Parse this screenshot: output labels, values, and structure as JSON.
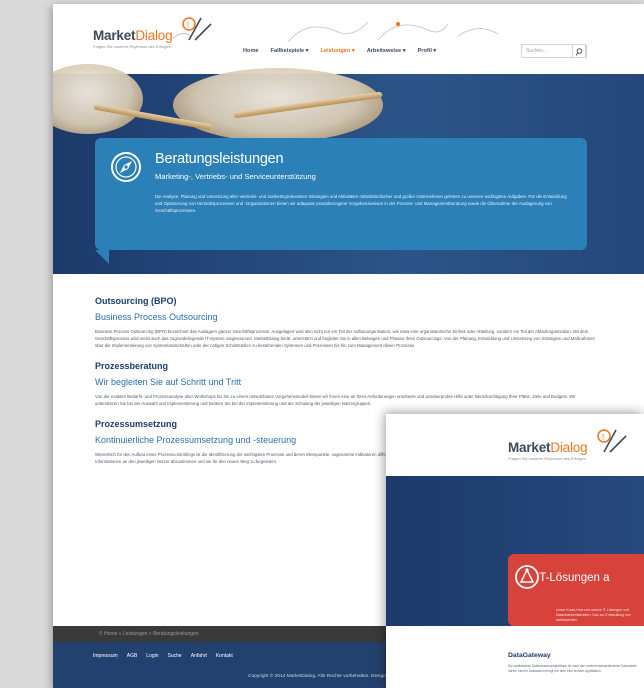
{
  "brand": {
    "name_part1": "Market",
    "name_part2": "Dialog",
    "tagline": "Fragen Sie unseren Rhythmus des Erfolges."
  },
  "nav": {
    "items": [
      {
        "label": "Home",
        "active": false
      },
      {
        "label": "Fallbeispiele ▾",
        "active": false
      },
      {
        "label": "Leistungen ▾",
        "active": true
      },
      {
        "label": "Arbeitsweise ▾",
        "active": false
      },
      {
        "label": "Profil ▾",
        "active": false
      }
    ],
    "search_placeholder": "Suchen..."
  },
  "callout": {
    "title": "Beratungsleistungen",
    "subtitle": "Marketing-, Vertriebs- und Serviceunterstützung",
    "text": "Die Analyse, Planung und Umsetzung aller vertriebs- und marketingrelevanten Strategien und Aktivitäten mittelständischer und großer Unternehmen gehören zu unseren wichtigsten Aufgaben. Für die Entwicklung und Optimierung von Vertriebsprozessen und -Organisationen bieten wir adäquate praxisbezogene Vorgehensweisen in der Prozess- und Managementberatung sowie die Übernahme der Auslagerung von Geschäftsprozessen.",
    "accent": "#2c80b8"
  },
  "sections": [
    {
      "heading": "Outsourcing (BPO)",
      "subheading": "Business Process Outsourcing",
      "text": "Business Process Outsourcing (BPO) bezeichnet das Auslagern ganzer Geschäftsprozesse. Ausgelagert wird also nicht nur ein Teil der Aufbauorganisation, wie etwa eine organisatorische Einheit oder Abteilung, sondern ein Teil der Ablauforganisation. Mit dem Geschäftsprozess wird meist auch das zugrundeliegende IT-System outgesourced. MarketDialog berät, unterstützt und begleitet Sie in allen Belangen und Phasen Ihres Outsourcings. Von der Planung, Entwicklung und Umsetzung von Strategien und Maßnahmen über die Implementierung von Systemlandschaften oder der nötigen Schnittstellen zu bestehenden Systemen und Prozessen bis hin zum Management dieser Prozesse."
    },
    {
      "heading": "Prozessberatung",
      "subheading": "Wir begleiten Sie auf Schritt und Tritt",
      "text": "Von der exakten Bedarfs- und Prozessanalyse über Workshops bis hin zu einem umsetzbaren Vorgehensmodell bieten wir Ihnen eine an Ihren Anforderungen orientierte und praxiserprobte Hilfe unter Berücksichtigung Ihrer Pläne, Ziele und Budgets. Wir unterstützen Sie bei der Auswahl und Implementierung und beraten Sie bei der Implementierung und der Schulung der jeweiligen Nutzergruppen."
    },
    {
      "heading": "Prozessumsetzung",
      "subheading": "Kontinuierliche Prozessumsetzung und -steuerung",
      "text": "Wesentlich für den Aufbau eines Prozesscontrollings ist die Identifizierung der wichtigsten Prozesse und deren Messpunkte, sogenannte Indikatoren differenziert werden. Unsere langjährige Praxiserfahrung macht es möglich Ihre Prozesse zu steuern und die Informationen an den jeweiligen Nutzer abzustimmen und sie für den neuen Weg zu begeistern."
    }
  ],
  "footer": {
    "breadcrumb": "⚲  Home  »  Leistungen  »  Beratungsleistungen",
    "links": [
      "Impressum",
      "AGB",
      "Login",
      "Suche",
      "Anfahrt",
      "Kontakt"
    ],
    "copyright": "Copyright © 2014 MarketDialog. Alle Rechte vorbehalten. Design"
  },
  "overlay": {
    "title": "IT-Lösungen a",
    "intro": "Unser Know-How und unsere IT-Lösungen und Datenbankentwicklern. Das zur Entwicklung von webbasierten",
    "section_heading": "DataGateway",
    "section_text": "Die webbasierte Datenaustauschplattform ist nach den unternehmensrelevante Dokumente dürfen nicht in Austausch erfolgt nur über eine sichere Applikation.",
    "accent": "#d7423a"
  }
}
